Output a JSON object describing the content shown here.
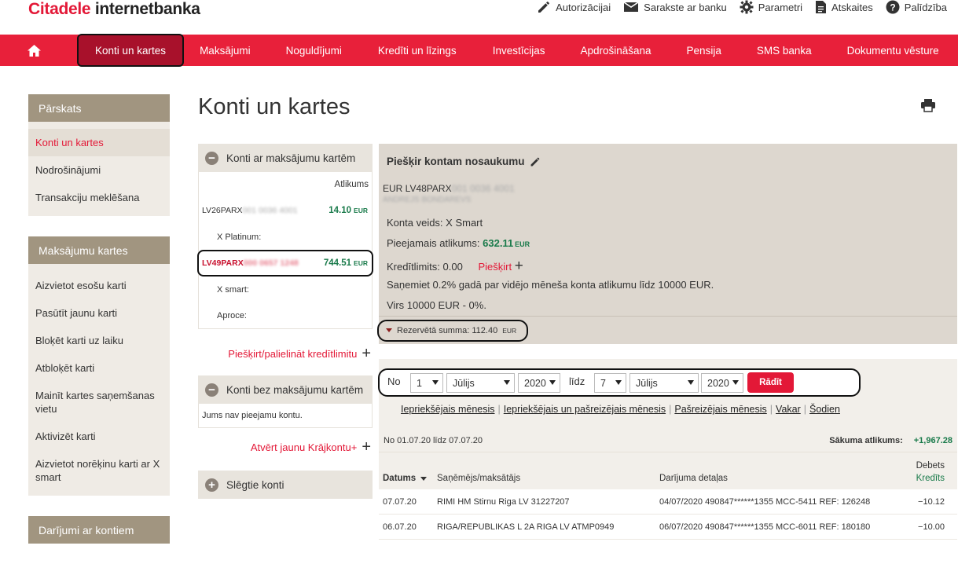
{
  "brand": {
    "name": "Citadele",
    "rest": "internetbanka"
  },
  "toplinks": [
    {
      "label": "Autorizācijai",
      "icon": "pencil-icon"
    },
    {
      "label": "Sarakste ar banku",
      "icon": "envelope-icon"
    },
    {
      "label": "Parametri",
      "icon": "gear-icon"
    },
    {
      "label": "Atskaites",
      "icon": "document-icon"
    },
    {
      "label": "Palīdzība",
      "icon": "help-icon"
    }
  ],
  "nav": [
    "Konti un kartes",
    "Maksājumi",
    "Noguldījumi",
    "Kredīti un līzings",
    "Investīcijas",
    "Apdrošināšana",
    "Pensija",
    "SMS banka",
    "Dokumentu vēsture"
  ],
  "left": {
    "overview": {
      "title": "Pārskats",
      "items": [
        "Konti un kartes",
        "Nodrošinājumi",
        "Transakciju meklēšana"
      ]
    },
    "cards": {
      "title": "Maksājumu kartes",
      "items": [
        "Aizvietot esošu karti",
        "Pasūtīt jaunu karti",
        "Bloķēt karti uz laiku",
        "Atbloķēt karti",
        "Mainīt kartes saņemšanas vietu",
        "Aktivizēt karti",
        "Aizvietot norēķinu karti ar X smart"
      ]
    },
    "transactions": {
      "title": "Darījumi ar kontiem"
    }
  },
  "page_title": "Konti un kartes",
  "accounts": {
    "with_cards_title": "Konti ar maksājumu kartēm",
    "balance_col": "Atlikums",
    "acc1": {
      "iban": "LV26PARX",
      "amount": "14.10",
      "cur": "EUR",
      "sub": "X Platinum:"
    },
    "acc2": {
      "iban": "LV49PARX",
      "amount": "744.51",
      "cur": "EUR",
      "sub1": "X smart:",
      "sub2": "Aproce:"
    },
    "credit_link": "Piešķirt/palielināt kredītlimitu",
    "without_cards_title": "Konti bez maksājumu kartēm",
    "no_accounts": "Jums nav pieejamu kontu.",
    "open_link": "Atvērt jaunu Krājkontu+",
    "closed_title": "Slēgtie konti"
  },
  "detail": {
    "title": "Piešķir kontam nosaukumu",
    "iban": "EUR LV48PARX",
    "type": "Konta veids: X Smart",
    "available_label": "Pieejamais atlikums:",
    "available_value": "632.11",
    "available_cur": "EUR",
    "credit_label": "Kredītlimits: 0.00",
    "credit_action": "Piešķirt",
    "promo1": "Saņemiet 0.2% gadā par vidējo mēneša konta atlikumu līdz 10000 EUR.",
    "promo2": "Virs 10000 EUR - 0%.",
    "reserved_label": "Rezervētā summa: 112.40",
    "reserved_cur": "EUR"
  },
  "filter": {
    "from_label": "No",
    "from_day": "1",
    "from_month": "Jūlijs",
    "from_year": "2020",
    "to_label": "līdz",
    "to_day": "7",
    "to_month": "Jūlijs",
    "to_year": "2020",
    "show_button": "Rādīt",
    "quick": [
      "Iepriekšējais mēnesis",
      "Iepriekšējais un pašreizējais mēnesis",
      "Pašreizējais mēnesis",
      "Vakar",
      "Šodien"
    ]
  },
  "table": {
    "range": "No 01.07.20 līdz 07.07.20",
    "start_balance_label": "Sākuma atlikums:",
    "start_balance": "+1,967.28",
    "headers": {
      "date": "Datums",
      "party": "Saņēmējs/maksātājs",
      "details": "Darījuma detaļas",
      "debit": "Debets",
      "credit": "Kredīts"
    },
    "rows": [
      {
        "date": "07.07.20",
        "party": "RIMI HM Stirnu Riga LV 31227207",
        "details": "04/07/2020 490847******1355 MCC-5411 REF: 126248",
        "amount": "−10.12"
      },
      {
        "date": "06.07.20",
        "party": "RIGA/REPUBLIKAS L 2A RIGA LV ATMP0949",
        "details": "06/07/2020 490847******1355 MCC-6011 REF: 180180",
        "amount": "−10.00"
      }
    ]
  },
  "colors": {
    "brand_red": "#e8203a",
    "nav_active": "#a8112b",
    "green": "#197a4a",
    "sidebar_header": "#a19580"
  }
}
